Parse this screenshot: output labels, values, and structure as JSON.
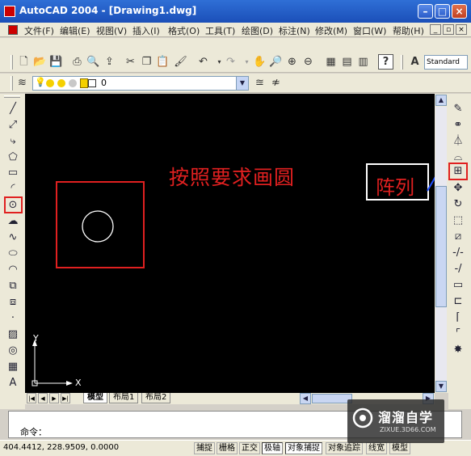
{
  "window": {
    "title": "AutoCAD 2004 - [Drawing1.dwg]"
  },
  "menu": [
    "文件(F)",
    "编辑(E)",
    "视图(V)",
    "插入(I)",
    "格式(O)",
    "工具(T)",
    "绘图(D)",
    "标注(N)",
    "修改(M)",
    "窗口(W)",
    "帮助(H)"
  ],
  "toolbar": {
    "text_style": "Standard"
  },
  "layer": {
    "current": "0"
  },
  "annotations": {
    "instruction": "按照要求画圆",
    "array_label": "阵列"
  },
  "axis": {
    "x": "X",
    "y": "Y"
  },
  "tabs": [
    "模型",
    "布局1",
    "布局2"
  ],
  "command": {
    "prompt": "命令："
  },
  "status": {
    "coords": "404.4412,  228.9509,  0.0000",
    "toggles": [
      "捕捉",
      "栅格",
      "正交",
      "极轴",
      "对象捕捉",
      "对象追踪",
      "线宽",
      "模型"
    ]
  },
  "watermark": {
    "brand": "溜溜自学",
    "url": "ZIXUE.3D66.COM"
  },
  "colors": {
    "highlight": "#e02020",
    "canvas": "#000000",
    "title_bar": "#1b4fb8"
  }
}
